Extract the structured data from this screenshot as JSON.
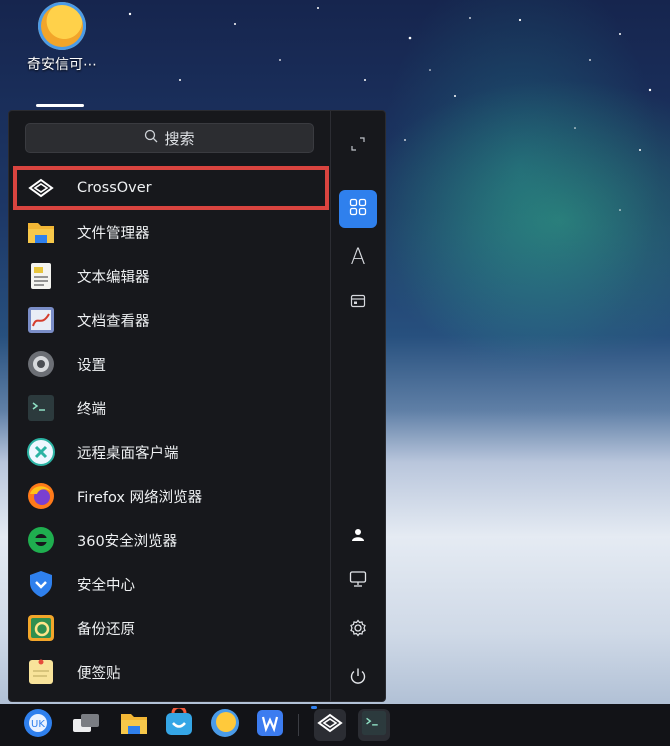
{
  "desktop": {
    "icon_label": "奇安信可⋯"
  },
  "menu": {
    "search_placeholder": "搜索",
    "items": [
      {
        "label": "CrossOver"
      },
      {
        "label": "文件管理器"
      },
      {
        "label": "文本编辑器"
      },
      {
        "label": "文档查看器"
      },
      {
        "label": "设置"
      },
      {
        "label": "终端"
      },
      {
        "label": "远程桌面客户端"
      },
      {
        "label": "Firefox 网络浏览器"
      },
      {
        "label": "360安全浏览器"
      },
      {
        "label": "安全中心"
      },
      {
        "label": "备份还原"
      },
      {
        "label": "便签贴"
      }
    ],
    "side_letter": "A"
  },
  "colors": {
    "highlight": "#d9443f",
    "accent": "#2f80ed"
  }
}
